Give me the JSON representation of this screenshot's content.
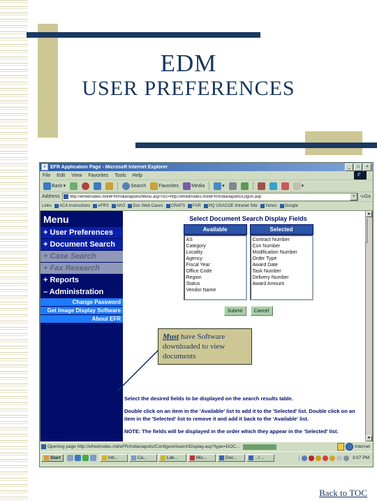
{
  "slide": {
    "title_line1": "EDM",
    "title_line2": "USER PREFERENCES",
    "toc_link": "Back to TOC",
    "accent_navy": "#1b3a61",
    "accent_tan": "#cdc795"
  },
  "browser": {
    "window_title": "EFR Application Page - Microsoft Internet Explorer",
    "window_buttons": [
      "_",
      "□",
      "×"
    ],
    "menu": [
      "File",
      "Edit",
      "View",
      "Favorites",
      "Tools",
      "Help"
    ],
    "toolbar": [
      {
        "label": "Back",
        "icon": "back-arrow-icon",
        "color": "#3b7bbf"
      },
      {
        "label": "",
        "icon": "forward-arrow-icon",
        "color": "#6fae6f"
      },
      {
        "label": "",
        "icon": "stop-icon",
        "color": "#b04040"
      },
      {
        "label": "",
        "icon": "refresh-icon",
        "color": "#3b7bbf"
      },
      {
        "label": "",
        "icon": "home-icon",
        "color": "#c8a23a"
      },
      {
        "label": "Search",
        "icon": "search-icon",
        "color": "#5a7fb8"
      },
      {
        "label": "Favorites",
        "icon": "favorites-star-icon",
        "color": "#c8a23a"
      },
      {
        "label": "Media",
        "icon": "media-icon",
        "color": "#7a5aa8"
      },
      {
        "label": "",
        "icon": "history-icon",
        "color": "#4a8ac0"
      },
      {
        "label": "",
        "icon": "mail-icon",
        "color": "#c0c0b0"
      },
      {
        "label": "",
        "icon": "print-icon",
        "color": "#808890"
      },
      {
        "label": "",
        "icon": "edit-icon",
        "color": "#5a9a5a"
      },
      {
        "label": "",
        "icon": "discuss-icon",
        "color": "#a05050"
      },
      {
        "label": "",
        "icon": "messenger-icon",
        "color": "#3aa0c8"
      },
      {
        "label": "",
        "icon": "research-icon",
        "color": "#c85a5a"
      }
    ],
    "address": {
      "label": "Address",
      "url": "http://efrednodes.mil/eFR/Indianapolis/Menu.asp?src=http://efrednodes.mil/eFR/Indianapolis/Logon.asp",
      "go_label": "Go",
      "favicon": "page-favicon",
      "dropdown": "▾"
    },
    "links": {
      "label": "Links",
      "items": [
        "ACA Instructions",
        "eFRS",
        "AKO",
        "Doc Web Cases",
        "CRAFS",
        "FAR",
        "HQ USACOE Intranet Site",
        "Yahoo",
        "Google"
      ]
    },
    "status": {
      "text": "Opening page http://efrednodes.mil/eFR/Indianapolis/ConfigureSearchDisplay.asp?type=DOC...",
      "zone": "Internet",
      "lock": "secure-lock-icon",
      "globe": "internet-zone-icon"
    },
    "taskbar": {
      "start_label": "Start",
      "quicklaunch": [
        {
          "name": "show-desktop-icon",
          "color": "#8aa0c0"
        },
        {
          "name": "ie-launch-icon",
          "color": "#3a7ac8"
        },
        {
          "name": "media-player-icon",
          "color": "#4aa84a"
        },
        {
          "name": "outlook-icon",
          "color": "#7a9ac8"
        }
      ],
      "tasks": [
        {
          "label": "Inb...",
          "color": "#d8b020"
        },
        {
          "label": "Ca...",
          "color": "#70a0d0"
        },
        {
          "label": "Lde...",
          "color": "#d8b020"
        },
        {
          "label": "Mic...",
          "color": "#c03030"
        },
        {
          "label": "Doc...",
          "color": "#3a62b8"
        },
        {
          "label": "...l ...",
          "color": "#3a62b8"
        }
      ],
      "tray": [
        {
          "name": "tray-volume-icon",
          "color": "#5a7ab8"
        },
        {
          "name": "tray-antivirus-icon",
          "color": "#c02020"
        },
        {
          "name": "tray-network-icon",
          "color": "#c8a020"
        },
        {
          "name": "tray-alert-icon",
          "color": "#d04040"
        },
        {
          "name": "tray-update-icon",
          "color": "#d0a030"
        },
        {
          "name": "tray-printer-icon",
          "color": "#c0c0c0"
        },
        {
          "name": "tray-modem-icon",
          "color": "#8090a0"
        }
      ],
      "clock": "3:07 PM"
    }
  },
  "app": {
    "menu_panel": {
      "heading": "Menu",
      "items": [
        {
          "label": "+ User Preferences",
          "state": "active"
        },
        {
          "label": "+ Document Search",
          "state": "active"
        },
        {
          "label": "+ Case Search",
          "state": "disabled"
        },
        {
          "label": "+ Fax Research",
          "state": "disabled"
        },
        {
          "label": "+ Reports",
          "state": "plain"
        },
        {
          "label": "– Administration",
          "state": "plain"
        }
      ],
      "subitems": [
        "Change Password",
        "Get Image Display Software",
        "About EFR"
      ]
    },
    "content": {
      "title": "Select Document Search Display Fields",
      "columns": [
        {
          "header": "Available",
          "items": [
            "AS",
            "Category",
            "Locality",
            "Agency",
            "Fiscal Year",
            "Office Code",
            "Region",
            "Status",
            "Vendor Name"
          ]
        },
        {
          "header": "Selected",
          "items": [
            "Contract Number",
            "Con Number",
            "Modification Number",
            "Order Type",
            "Award Date",
            "Task Number",
            "Delivery Number",
            "Award Amount"
          ]
        }
      ],
      "buttons": [
        "Submit",
        "Cancel"
      ],
      "instructions": [
        "Select the desired fields to be displayed on the search results table.",
        "Double click on an item in the 'Available' list to add it to the 'Selected' list. Double click on an item in the 'Selected' list to remove it and add it back to the 'Available' list.",
        "NOTE: The fields will be displayed in the order which they appear in the 'Selected' list."
      ]
    }
  },
  "callout": {
    "emphasis": "Must",
    "rest": " have Software downloaded to view documents"
  }
}
